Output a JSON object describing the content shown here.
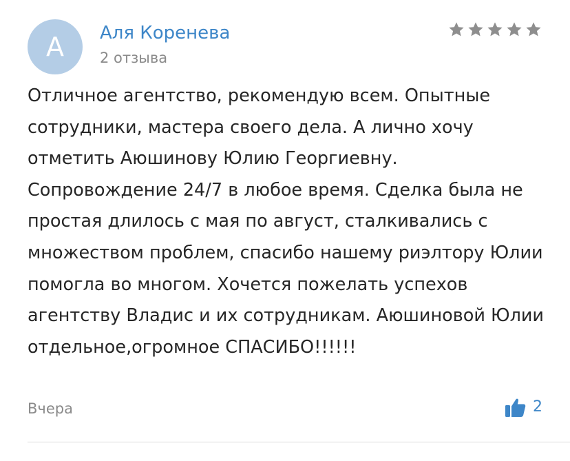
{
  "review": {
    "author": {
      "avatar_letter": "А",
      "name": "Аля Коренева",
      "reviews_count": "2 отзыва"
    },
    "rating": {
      "stars": 5,
      "max": 5,
      "star_color": "#8e8e8e"
    },
    "text": "Отличное агентство, рекомендую всем. Опытные сотрудники, мастера своего дела. А лично хочу отметить Аюшинову Юлию Георгиевну. Сопровождение 24/7 в любое время. Сделка была не простая длилось с мая по август, сталкивались с множеством проблем, спасибо нашему риэлтору Юлии помогла во многом. Хочется пожелать успехов агентству Владис и их сотрудникам. Аюшиновой Юлии отдельное,огромное СПАСИБО!!!!!!",
    "date": "Вчера",
    "likes": {
      "icon": "thumbs-up-icon",
      "count": "2"
    }
  },
  "colors": {
    "accent": "#3d86c8",
    "avatar_bg": "#b4cde6",
    "muted_text": "#8a8a8a",
    "body_text": "#262626"
  }
}
